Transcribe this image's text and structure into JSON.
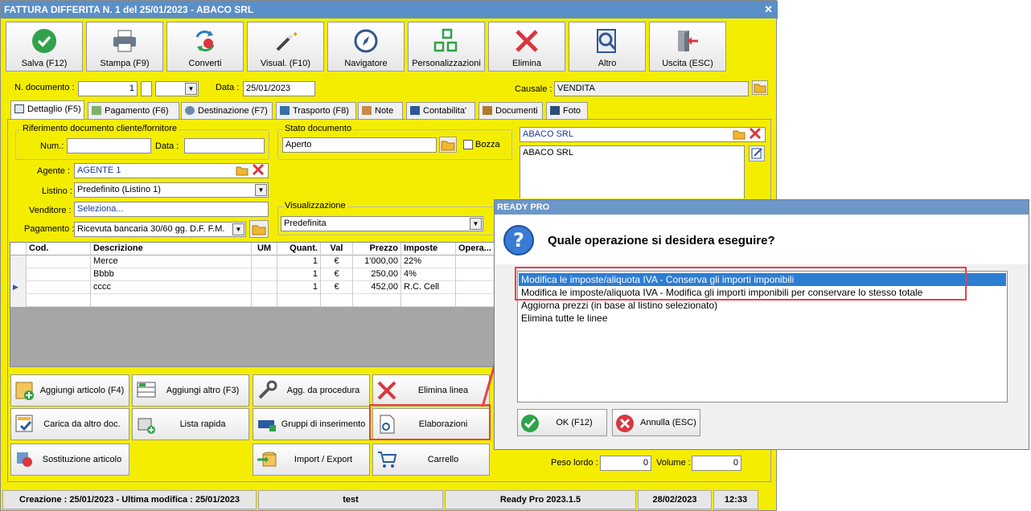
{
  "window": {
    "title": "FATTURA DIFFERITA N. 1 del 25/01/2023 - ABACO SRL",
    "close_glyph": "✕"
  },
  "toolbar": [
    {
      "label": "Salva (F12)",
      "icon": "check-icon"
    },
    {
      "label": "Stampa (F9)",
      "icon": "printer-icon"
    },
    {
      "label": "Converti",
      "icon": "convert-icon"
    },
    {
      "label": "Visual. (F10)",
      "icon": "magic-wand-icon"
    },
    {
      "label": "Navigatore",
      "icon": "compass-icon"
    },
    {
      "label": "Personalizzazioni",
      "icon": "grid-icon"
    },
    {
      "label": "Elimina",
      "icon": "delete-icon"
    },
    {
      "label": "Altro",
      "icon": "search-doc-icon"
    },
    {
      "label": "Uscita (ESC)",
      "icon": "exit-icon"
    }
  ],
  "header": {
    "ndoc_label": "N. documento :",
    "ndoc_value": "1",
    "data_label": "Data :",
    "data_value": "25/01/2023",
    "causale_label": "Causale :",
    "causale_value": "VENDITA"
  },
  "tabs": [
    {
      "label": "Dettaglio (F5)",
      "active": true
    },
    {
      "label": "Pagamento (F6)"
    },
    {
      "label": "Destinazione (F7)"
    },
    {
      "label": "Trasporto (F8)"
    },
    {
      "label": "Note"
    },
    {
      "label": "Contabilita'"
    },
    {
      "label": "Documenti"
    },
    {
      "label": "Foto"
    }
  ],
  "rif": {
    "group_title": "Riferimento documento cliente/fornitore",
    "num_label": "Num.:",
    "num_value": "",
    "data_label": "Data :",
    "data_value": ""
  },
  "stato": {
    "group_title": "Stato documento",
    "value": "Aperto",
    "bozza_label": "Bozza"
  },
  "cliente": {
    "name": "ABACO SRL",
    "address_text": "ABACO SRL"
  },
  "fields": {
    "agente_label": "Agente :",
    "agente_value": "AGENTE 1",
    "listino_label": "Listino :",
    "listino_value": "Predefinito (Listino 1)",
    "venditore_label": "Venditore :",
    "venditore_value": "Seleziona...",
    "pagamento_label": "Pagamento :",
    "pagamento_value": "Ricevuta bancaria 30/60 gg. D.F. F.M.",
    "visual_group": "Visualizzazione",
    "visual_value": "Predefinita"
  },
  "grid": {
    "columns": [
      "Cod.",
      "Descrizione",
      "UM",
      "Quant.",
      "Val",
      "Prezzo",
      "Imposte",
      "Opera..."
    ],
    "rows": [
      [
        "",
        "Merce",
        "",
        "1",
        "€",
        "1'000,00",
        "22%",
        ""
      ],
      [
        "",
        "Bbbb",
        "",
        "1",
        "€",
        "250,00",
        "4%",
        ""
      ],
      [
        "",
        "cccc",
        "",
        "1",
        "€",
        "452,00",
        "R.C. Cell",
        ""
      ]
    ]
  },
  "actions": [
    {
      "label": "Aggiungi articolo (F4)",
      "icon": "add-article-icon"
    },
    {
      "label": "Aggiungi altro (F3)",
      "icon": "add-other-icon"
    },
    {
      "label": "Agg. da procedura",
      "icon": "wrench-icon"
    },
    {
      "label": "Elimina linea",
      "icon": "delete-line-icon"
    },
    {
      "label": "Carica da altro doc.",
      "icon": "load-doc-icon"
    },
    {
      "label": "Lista rapida",
      "icon": "quick-list-icon"
    },
    {
      "label": "Gruppi di inserimento",
      "icon": "insert-group-icon"
    },
    {
      "label": "Elaborazioni",
      "icon": "processing-icon"
    },
    {
      "label": "Sostituzione articolo",
      "icon": "replace-icon"
    },
    {
      "label": "Import / Export",
      "icon": "import-export-icon"
    },
    {
      "label": "Carrello",
      "icon": "cart-icon"
    }
  ],
  "weights": {
    "peso_lordo_label": "Peso lordo :",
    "peso_lordo_value": "0",
    "volume_label": "Volume :",
    "volume_value": "0"
  },
  "statusbar": {
    "dates": "Creazione : 25/01/2023 - Ultima modifica : 25/01/2023",
    "user": "test",
    "version": "Ready Pro 2023.1.5",
    "date": "28/02/2023",
    "time": "12:33"
  },
  "dialog": {
    "title": "READY PRO",
    "question": "Quale operazione si desidera eseguire?",
    "options": [
      "Modifica le imposte/aliquota IVA - Conserva gli importi imponibili",
      "Modifica le imposte/aliquota IVA - Modifica gli importi imponibili per conservare lo stesso totale",
      "Aggiorna prezzi (in base al listino selezionato)",
      "Elimina tutte le linee"
    ],
    "selected_index": 0,
    "ok_label": "OK (F12)",
    "cancel_label": "Annulla (ESC)"
  },
  "colors": {
    "window_bg": "#f4ed00",
    "title_blue": "#5a8fc8",
    "highlight": "#e8404a",
    "selection": "#2d7dd2"
  }
}
